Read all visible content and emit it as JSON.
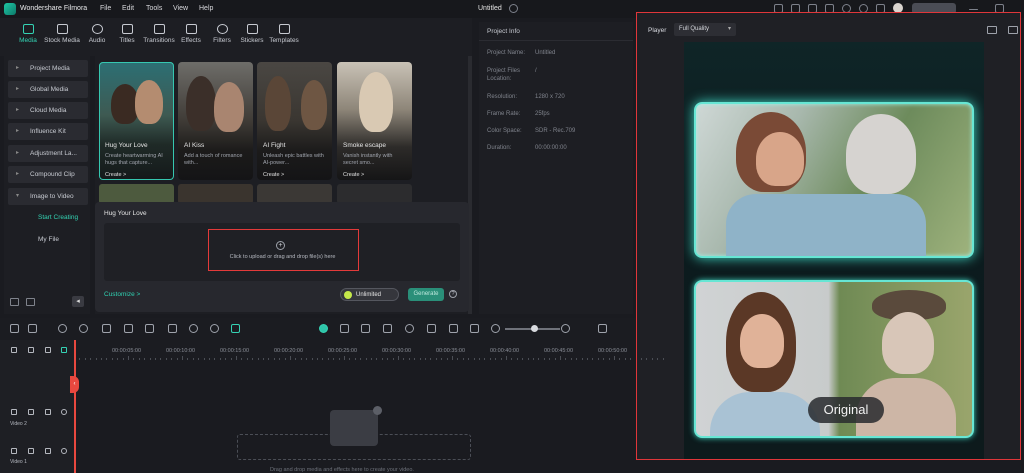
{
  "app": {
    "name": "Wondershare Filmora",
    "document_title": "Untitled"
  },
  "menu": [
    "File",
    "Edit",
    "Tools",
    "View",
    "Help"
  ],
  "toolbar": {
    "items": [
      {
        "label": "Media",
        "icon": "media-icon",
        "active": true
      },
      {
        "label": "Stock Media",
        "icon": "stock-media-icon",
        "active": false
      },
      {
        "label": "Audio",
        "icon": "audio-icon",
        "active": false
      },
      {
        "label": "Titles",
        "icon": "titles-icon",
        "active": false
      },
      {
        "label": "Transitions",
        "icon": "transitions-icon",
        "active": false
      },
      {
        "label": "Effects",
        "icon": "effects-icon",
        "active": false
      },
      {
        "label": "Filters",
        "icon": "filters-icon",
        "active": false
      },
      {
        "label": "Stickers",
        "icon": "stickers-icon",
        "active": false
      },
      {
        "label": "Templates",
        "icon": "templates-icon",
        "active": false
      }
    ]
  },
  "sidebar": {
    "items": [
      "Project Media",
      "Global Media",
      "Cloud Media",
      "Influence Kit",
      "Adjustment La...",
      "Compound Clip",
      "Image to Video"
    ],
    "sub_items": [
      {
        "label": "Start Creating",
        "active": true
      },
      {
        "label": "My File",
        "active": false
      }
    ]
  },
  "media_cards": [
    {
      "title": "Hug Your Love",
      "desc": "Create heartwarming AI hugs that capture...",
      "cta": "Create >"
    },
    {
      "title": "AI Kiss",
      "desc": "Add a touch of romance with...",
      "cta": ""
    },
    {
      "title": "AI Fight",
      "desc": "Unleash epic battles with AI-power...",
      "cta": "Create >"
    },
    {
      "title": "Smoke escape",
      "desc": "Vanish instantly with secret smo...",
      "cta": "Create >"
    }
  ],
  "popup": {
    "title": "Hug Your Love",
    "upload_text": "Click to upload or drag and drop file(s) here",
    "customize": "Customize >",
    "unlimited": "Unlimited",
    "generate": "Generate"
  },
  "project_info": {
    "heading": "Project Info",
    "fields": [
      {
        "label": "Project Name:",
        "value": "Untitled"
      },
      {
        "label": "Project Files Location:",
        "value": "/"
      },
      {
        "label": "Resolution:",
        "value": "1280 x 720"
      },
      {
        "label": "Frame Rate:",
        "value": "25fps"
      },
      {
        "label": "Color Space:",
        "value": "SDR - Rec.709"
      },
      {
        "label": "Duration:",
        "value": "00:00:00:00"
      }
    ]
  },
  "player": {
    "label": "Player",
    "quality": "Full Quality",
    "overlay_badge": "Original"
  },
  "timeline": {
    "timecodes": [
      "00:00:05:00",
      "00:00:10:00",
      "00:00:15:00",
      "00:00:20:00",
      "00:00:25:00",
      "00:00:30:00",
      "00:00:35:00",
      "00:00:40:00",
      "00:00:45:00",
      "00:00:50:00"
    ],
    "tracks": [
      {
        "label": "Video 2",
        "number": "2"
      },
      {
        "label": "Video 1",
        "number": "1"
      }
    ],
    "drop_text": "Drag and drop media and effects here to create your video."
  },
  "colors": {
    "accent": "#34d3b4",
    "highlight": "#e33a3a",
    "glow": "#67e6d4"
  }
}
